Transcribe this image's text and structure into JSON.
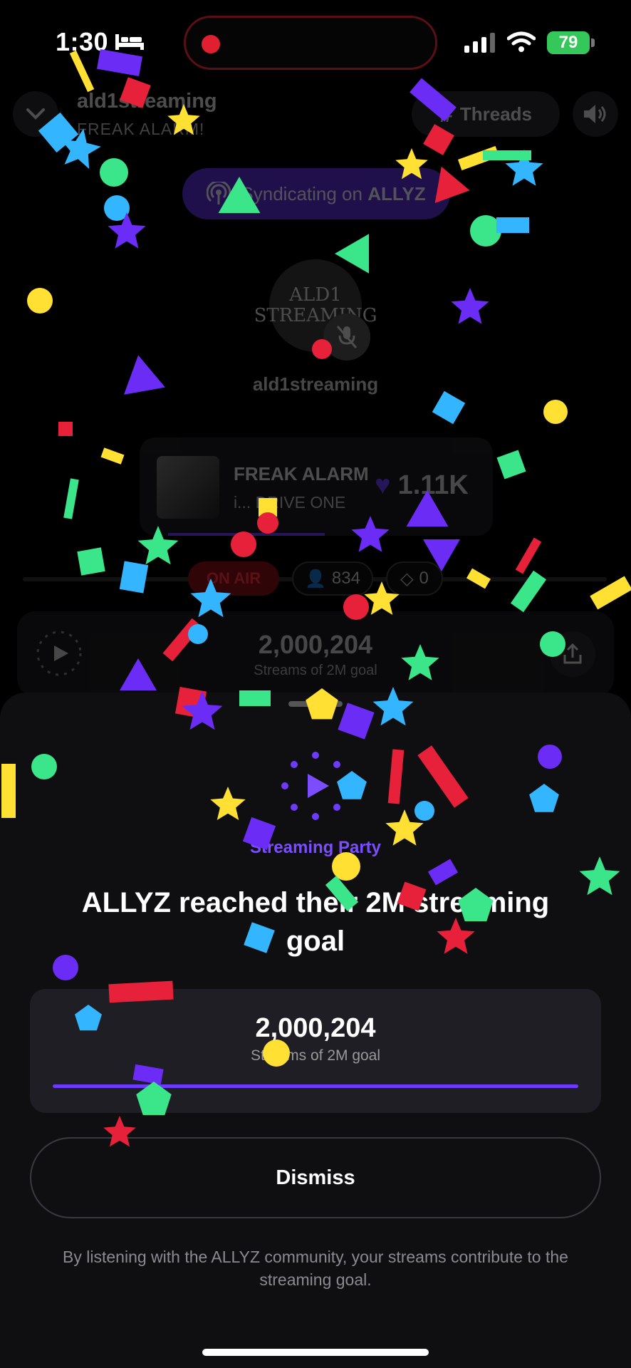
{
  "status_bar": {
    "time": "1:30",
    "battery": "79",
    "icons": [
      "bed-icon",
      "signal-icon",
      "wifi-icon",
      "battery-icon"
    ]
  },
  "header": {
    "show_title": "ald1streaming",
    "show_subtitle": "FREAK ALARM!",
    "threads_label": "Threads",
    "syndicating_prefix": "Syndicating on ",
    "syndicating_brand": "ALLYZ"
  },
  "host": {
    "avatar_text": "ALD1 STREAMING",
    "name": "ald1streaming"
  },
  "now_playing": {
    "title": "FREAK ALARM",
    "artist": "i... DRIVE ONE",
    "likes": "1.11K"
  },
  "stats": {
    "on_air": "ON AIR",
    "listeners": "834",
    "gems": "0"
  },
  "background_goal": {
    "count": "2,000,204",
    "label": "Streams of 2M goal"
  },
  "sheet": {
    "party_label": "Streaming Party",
    "title": "ALLYZ reached their 2M streaming goal",
    "goal_count": "2,000,204",
    "goal_label": "Streams of 2M goal",
    "goal_progress": 1.0,
    "dismiss_label": "Dismiss",
    "footnote": "By listening with the ALLYZ community, your streams contribute to the streaming goal."
  },
  "colors": {
    "accent_purple": "#6b3cff",
    "on_air_red": "#ff3344",
    "battery_green": "#34c759",
    "confetti": [
      "#ffe033",
      "#e8213a",
      "#6b2cf5",
      "#33b6ff",
      "#3be58a"
    ]
  }
}
